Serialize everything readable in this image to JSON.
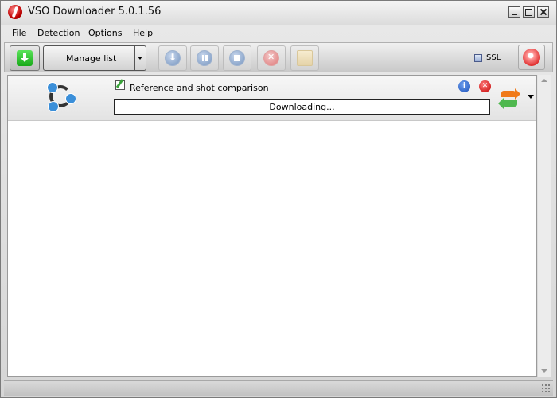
{
  "window": {
    "title": "VSO Downloader 5.0.1.56"
  },
  "menu": {
    "items": [
      "File",
      "Detection",
      "Options",
      "Help"
    ]
  },
  "toolbar": {
    "manage_label": "Manage list",
    "ssl_label": "SSL",
    "ssl_checked": false,
    "buttons": [
      "add-download",
      "download",
      "pause",
      "stop",
      "cancel",
      "burn"
    ]
  },
  "downloads": [
    {
      "title": "Reference and shot comparison",
      "status": "Downloading...",
      "progress_percent": 0
    }
  ],
  "colors": {
    "progress_fill": "#9bd39b",
    "accent_green": "#18a918",
    "info_blue": "#1a4fb8",
    "remove_red": "#c20000"
  }
}
